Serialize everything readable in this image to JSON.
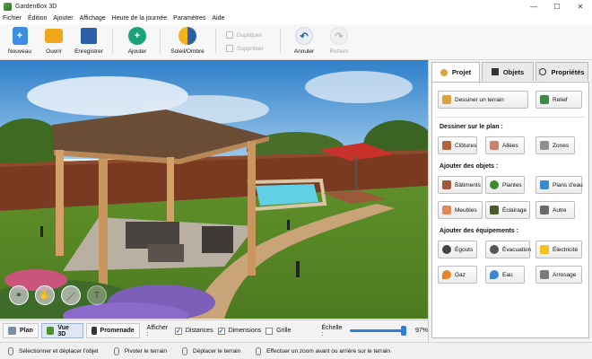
{
  "window": {
    "title": "GardenBox 3D",
    "minimize": "—",
    "maximize": "☐",
    "close": "✕"
  },
  "menu": [
    "Fichier",
    "Édition",
    "Ajouter",
    "Affichage",
    "Heure de la journée",
    "Paramètres",
    "Aide"
  ],
  "toolbar": {
    "new": "Nouveau",
    "open": "Ouvrir",
    "save": "Enregistrer",
    "add": "Ajouter",
    "sun_shade": "Soleil/Ombre",
    "duplicate": "Dupliquer",
    "delete": "Supprimer",
    "undo": "Annuler",
    "redo": "Refaire"
  },
  "view_modes": {
    "plan": "Plan",
    "view3d": "Vue 3D",
    "walk": "Promenade",
    "active": "Vue 3D"
  },
  "display": {
    "label": "Afficher :",
    "distances": {
      "label": "Distances",
      "checked": true
    },
    "dimensions": {
      "label": "Dimensions",
      "checked": true
    },
    "grid": {
      "label": "Grille",
      "checked": false
    }
  },
  "scale": {
    "label": "Échelle :",
    "value": "97%",
    "level": 0.97
  },
  "status": [
    "Sélectionner et déplacer l'objet",
    "Pivoter le terrain",
    "Déplacer le terrain",
    "Effectuer un zoom avant ou arrière sur le terrain"
  ],
  "panel": {
    "tabs": [
      "Projet",
      "Objets",
      "Propriétés"
    ],
    "active_tab": "Projet",
    "draw_terrain": "Dessiner un terrain",
    "relief": "Relief",
    "section_draw": "Dessiner sur le plan :",
    "draw_items": [
      "Clôtures",
      "Allées",
      "Zones"
    ],
    "section_objects": "Ajouter des objets :",
    "object_items": [
      "Bâtiments",
      "Plantes",
      "Plans d'eau",
      "Meubles",
      "Éclairage",
      "Autre"
    ],
    "section_equipment": "Ajouter des équipements :",
    "equipment_items": [
      "Égouts",
      "Évacuation",
      "Électricité",
      "Gaz",
      "Eau",
      "Arrosage"
    ]
  },
  "colors": {
    "accent": "#2e7fd6",
    "add_button": "#1aa37a",
    "sun_icon": "#f2b31b"
  }
}
